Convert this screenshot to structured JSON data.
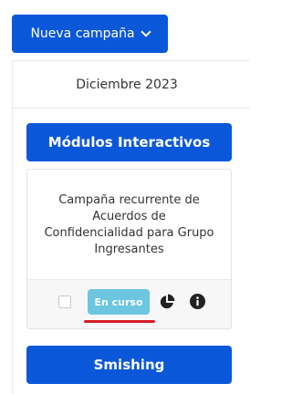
{
  "header": {
    "new_campaign_label": "Nueva campaña"
  },
  "calendar": {
    "month_label": "Diciembre 2023"
  },
  "modules": [
    {
      "label": "Módulos Interactivos",
      "campaign": {
        "title": "Campaña recurrente de Acuerdos de Confidencialidad para Grupo Ingresantes",
        "status": "En curso"
      }
    },
    {
      "label": "Smishing"
    }
  ],
  "icons": {
    "dropdown": "chevron-down-icon",
    "stats": "pie-chart-icon",
    "info": "info-icon"
  },
  "colors": {
    "primary": "#0b57d9",
    "status_badge": "#6cc6df",
    "highlight_underline": "#d81b24"
  }
}
